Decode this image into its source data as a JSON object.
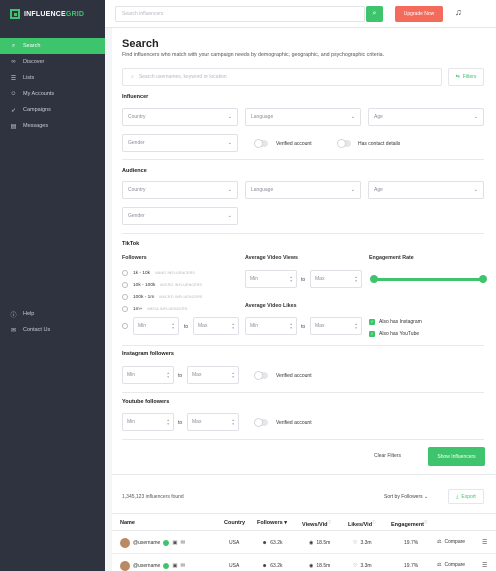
{
  "brand": {
    "name_part1": "INFLUENCE",
    "name_part2": "GRID"
  },
  "colors": {
    "accent": "#3ec46d",
    "sidebar": "#2f3340",
    "upgrade": "#f46a5b"
  },
  "topbar": {
    "search_placeholder": "Search influencers",
    "upgrade_label": "Upgrade Now",
    "search_icon": "search-icon",
    "bell_icon": "bell-icon"
  },
  "sidebar": {
    "items": [
      {
        "label": "Search",
        "icon": "search-icon",
        "active": true
      },
      {
        "label": "Discover",
        "icon": "binoculars-icon"
      },
      {
        "label": "Lists",
        "icon": "list-icon"
      },
      {
        "label": "My Accounts",
        "icon": "users-icon"
      },
      {
        "label": "Campaigns",
        "icon": "rocket-icon"
      },
      {
        "label": "Messages",
        "icon": "message-icon"
      }
    ],
    "bottom_items": [
      {
        "label": "Help",
        "icon": "help-icon"
      },
      {
        "label": "Contact Us",
        "icon": "mail-icon"
      }
    ]
  },
  "page": {
    "title": "Search",
    "subtitle": "Find influencers who match with your campaign needs by demographic, geographic, and psychographic criteria.",
    "search_placeholder": "Search usernames, keyword or location",
    "filters_label": "Filters"
  },
  "influencer": {
    "title": "Influencer",
    "country": "Country",
    "language": "Language",
    "age": "Age",
    "gender": "Gender",
    "verified_label": "Verified account",
    "contact_label": "Has contact details"
  },
  "audience": {
    "title": "Audience",
    "country": "Country",
    "language": "Language",
    "age": "Age",
    "gender": "Gender"
  },
  "tiktok": {
    "title": "TikTok",
    "followers_title": "Followers",
    "options": [
      {
        "label": "1k - 10k",
        "tag": "NANO INFLUENCERS"
      },
      {
        "label": "10k - 100k",
        "tag": "MICRO INFLUENCERS"
      },
      {
        "label": "100k - 1m",
        "tag": "MACRO INFLUENCERS"
      },
      {
        "label": "1m+",
        "tag": "MEGA INFLUENCERS"
      }
    ],
    "avg_views_title": "Average Video Views",
    "avg_likes_title": "Average Video Likes",
    "engagement_title": "Engagement Rate",
    "min": "Min",
    "max": "Max",
    "to": "to",
    "has_instagram": "Also has Instagram",
    "has_youtube": "Also has YouTube"
  },
  "instagram": {
    "title": "Instagram followers",
    "min": "Min",
    "max": "Max",
    "to": "to",
    "verified_label": "Verified account"
  },
  "youtube": {
    "title": "Youtube followers",
    "min": "Min",
    "max": "Max",
    "to": "to",
    "verified_label": "Verified account"
  },
  "actions": {
    "clear": "Clear Filters",
    "show": "Show Influencers"
  },
  "results": {
    "count": "1,345,123 influencers found",
    "sort": "Sort by Followers",
    "export": "Export"
  },
  "table": {
    "headers": {
      "name": "Name",
      "country": "Country",
      "followers": "Followers",
      "views": "Views/Vid",
      "likes": "Likes/Vid",
      "engagement": "Engagement"
    },
    "rows": [
      {
        "username": "@username",
        "country": "USA",
        "followers": "63.2k",
        "views": "18.5m",
        "likes": "3.3m",
        "engagement": "19.7%",
        "compare": "Compare"
      },
      {
        "username": "@username",
        "country": "USA",
        "followers": "63.2k",
        "views": "18.5m",
        "likes": "3.3m",
        "engagement": "19.7%",
        "compare": "Compare"
      }
    ]
  }
}
